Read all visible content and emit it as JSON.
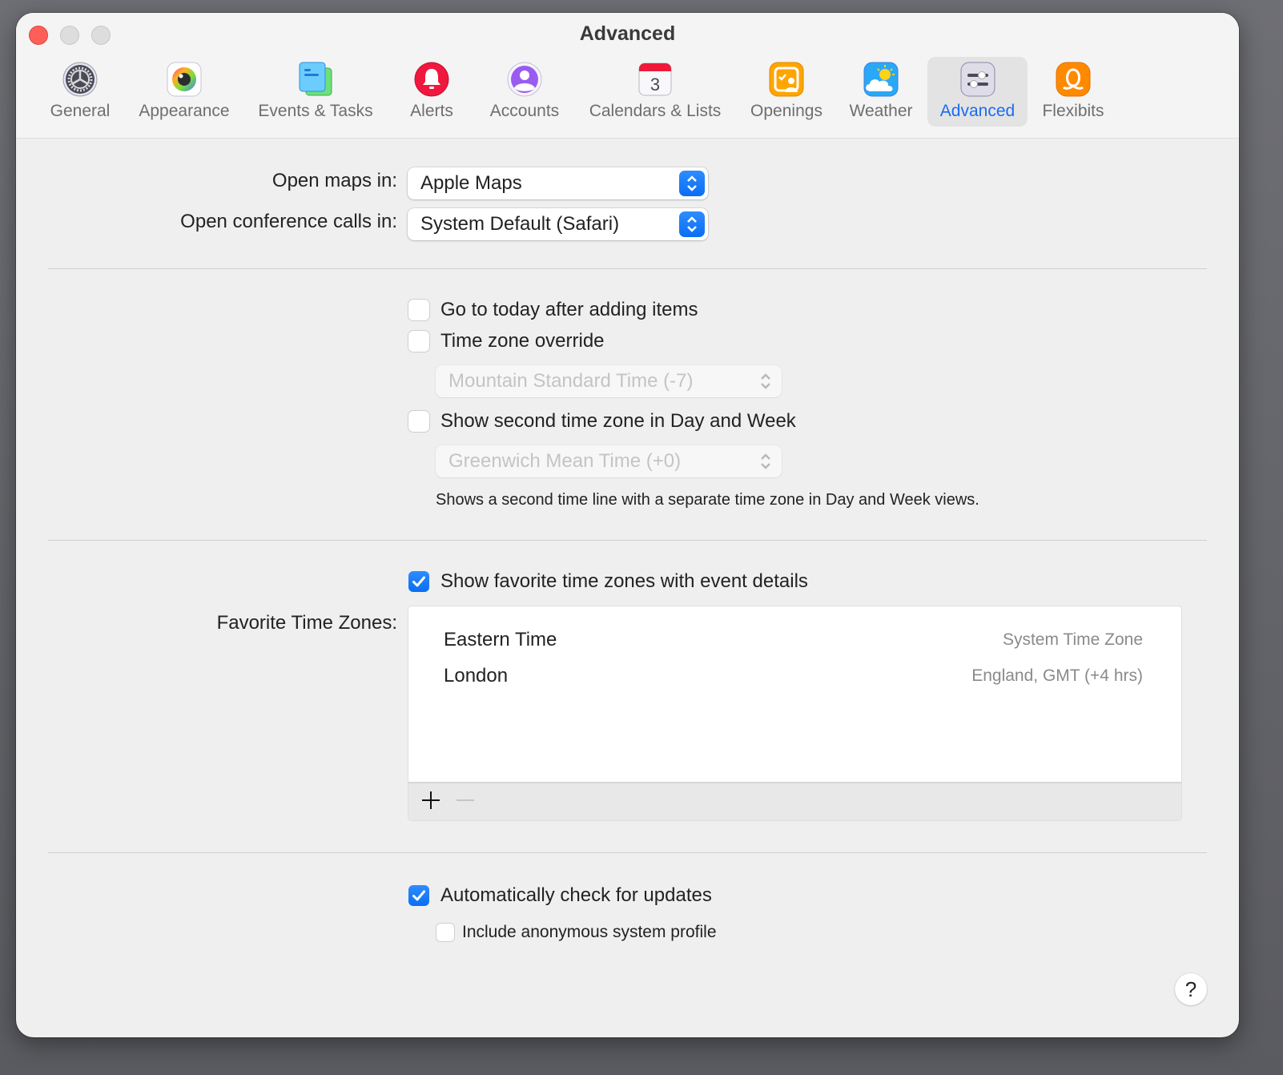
{
  "window": {
    "title": "Advanced"
  },
  "tabs": [
    {
      "id": "general",
      "label": "General",
      "icon": "gear-icon"
    },
    {
      "id": "appearance",
      "label": "Appearance",
      "icon": "color-eye-icon"
    },
    {
      "id": "events-tasks",
      "label": "Events & Tasks",
      "icon": "documents-icon"
    },
    {
      "id": "alerts",
      "label": "Alerts",
      "icon": "bell-icon"
    },
    {
      "id": "accounts",
      "label": "Accounts",
      "icon": "person-circle-icon"
    },
    {
      "id": "calendars-lists",
      "label": "Calendars & Lists",
      "icon": "calendar-icon",
      "badge": "3"
    },
    {
      "id": "openings",
      "label": "Openings",
      "icon": "openings-icon"
    },
    {
      "id": "weather",
      "label": "Weather",
      "icon": "weather-icon"
    },
    {
      "id": "advanced",
      "label": "Advanced",
      "icon": "sliders-icon",
      "active": true
    },
    {
      "id": "flexibits",
      "label": "Flexibits",
      "icon": "flexibits-logo-icon"
    }
  ],
  "settings": {
    "open_maps": {
      "label": "Open maps in:",
      "value": "Apple Maps"
    },
    "open_calls": {
      "label": "Open conference calls in:",
      "value": "System Default (Safari)"
    },
    "go_to_today": {
      "label": "Go to today after adding items",
      "checked": false
    },
    "tz_override": {
      "label": "Time zone override",
      "checked": false,
      "value": "Mountain Standard Time (-7)"
    },
    "second_tz": {
      "label": "Show second time zone in Day and Week",
      "checked": false,
      "value": "Greenwich Mean Time (+0)",
      "note": "Shows a second time line with a separate time zone in Day and Week views."
    },
    "show_favorites": {
      "label": "Show favorite time zones with event details",
      "checked": true
    },
    "favorites": {
      "label": "Favorite Time Zones:",
      "items": [
        {
          "name": "Eastern Time",
          "detail": "System Time Zone"
        },
        {
          "name": "London",
          "detail": "England, GMT (+4 hrs)"
        }
      ],
      "add_label": "+",
      "remove_label": "−"
    },
    "auto_update": {
      "label": "Automatically check for updates",
      "checked": true
    },
    "anon_profile": {
      "label": "Include anonymous system profile",
      "checked": false
    }
  },
  "help": {
    "label": "?"
  },
  "colors": {
    "accent": "#0a6ef3",
    "close": "#fe5f57"
  }
}
